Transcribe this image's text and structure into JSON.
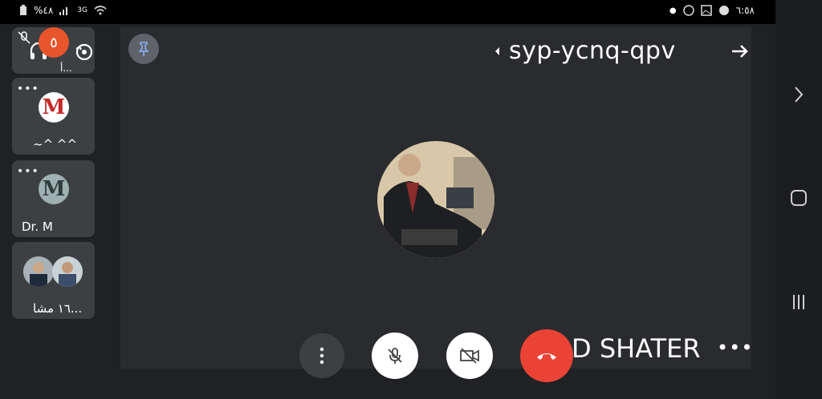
{
  "status_bar": {
    "left_text": "%٤٨",
    "network": "3G",
    "time": "٦:٥٨"
  },
  "meeting": {
    "code": "syp-ycnq-qpv",
    "presenter_name": "D SHATER"
  },
  "participants": {
    "count_badge": "٥",
    "tiles": [
      {
        "label": "أ...",
        "muted": true
      },
      {
        "label": "~^ ^^",
        "avatar_letter": "M",
        "avatar_color": "#c62828"
      },
      {
        "label": "Dr. M",
        "avatar_letter": "M",
        "avatar_color": "#5b6b6b"
      },
      {
        "label": "١٦ مشا..."
      }
    ]
  },
  "controls": {
    "end_call_color": "#ea4335"
  },
  "icons": [
    "battery-icon",
    "signal-icon",
    "wifi-icon",
    "viber-icon",
    "gallery-icon",
    "globe-icon",
    "pin-icon",
    "speaker-arrow-icon",
    "arrow-right-icon",
    "camera-switch-icon",
    "headset-icon",
    "more-vert-icon",
    "mic-off-icon",
    "camera-off-icon",
    "call-end-icon",
    "nav-forward-icon",
    "nav-home-icon",
    "nav-recents-icon"
  ]
}
